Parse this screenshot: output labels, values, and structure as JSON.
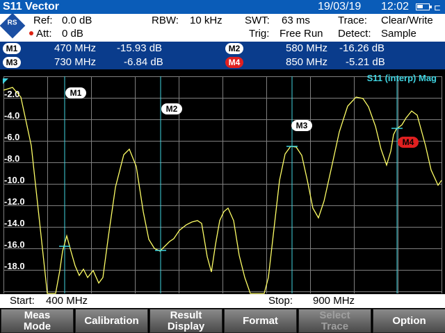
{
  "titlebar": {
    "title": "S11 Vector",
    "date": "19/03/19",
    "time": "12:02"
  },
  "settings": {
    "ref_label": "Ref:",
    "ref_value": "0.0 dB",
    "att_label": "Att:",
    "att_value": "0 dB",
    "rbw_label": "RBW:",
    "rbw_value": "10 kHz",
    "swt_label": "SWT:",
    "swt_value": "63 ms",
    "trig_label": "Trig:",
    "trig_value": "Free Run",
    "trace_label": "Trace:",
    "trace_value": "Clear/Write",
    "detect_label": "Detect:",
    "detect_value": "Sample"
  },
  "markers": [
    {
      "name": "M1",
      "freq": "470 MHz",
      "level": "-15.93 dB"
    },
    {
      "name": "M2",
      "freq": "580 MHz",
      "level": "-16.26 dB"
    },
    {
      "name": "M3",
      "freq": "730 MHz",
      "level": "-6.84 dB"
    },
    {
      "name": "M4",
      "freq": "850 MHz",
      "level": "-5.21 dB",
      "active": true
    }
  ],
  "plot": {
    "trace_title": "S11 (interp) Mag",
    "y_labels": [
      "-2.0",
      "-4.0",
      "-6.0",
      "-8.0",
      "-10.0",
      "-12.0",
      "-14.0",
      "-16.0",
      "-18.0"
    ]
  },
  "status": {
    "start_label": "Start:",
    "start_value": "400 MHz",
    "stop_label": "Stop:",
    "stop_value": "900 MHz"
  },
  "softkeys": [
    {
      "label": "Meas\nMode",
      "enabled": true
    },
    {
      "label": "Calibration",
      "enabled": true
    },
    {
      "label": "Result\nDisplay",
      "enabled": true
    },
    {
      "label": "Format",
      "enabled": true
    },
    {
      "label": "Select\nTrace",
      "enabled": false
    },
    {
      "label": "Option",
      "enabled": true
    }
  ],
  "colors": {
    "trace": "#ffff66",
    "marker_line": "#3fd3e0",
    "header": "#0a5cb8"
  }
}
